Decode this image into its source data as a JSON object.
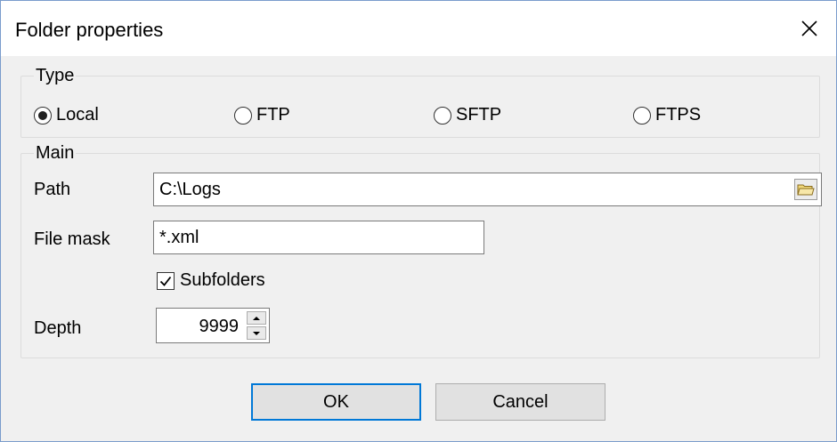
{
  "window": {
    "title": "Folder properties"
  },
  "type_group": {
    "legend": "Type",
    "options": [
      {
        "label": "Local",
        "checked": true
      },
      {
        "label": "FTP",
        "checked": false
      },
      {
        "label": "SFTP",
        "checked": false
      },
      {
        "label": "FTPS",
        "checked": false
      }
    ]
  },
  "main_group": {
    "legend": "Main",
    "path_label": "Path",
    "path_value": "C:\\Logs",
    "filemask_label": "File mask",
    "filemask_value": "*.xml",
    "subfolders_label": "Subfolders",
    "subfolders_checked": true,
    "depth_label": "Depth",
    "depth_value": "9999"
  },
  "buttons": {
    "ok": "OK",
    "cancel": "Cancel"
  },
  "icons": {
    "close": "close-icon",
    "browse": "folder-open-icon",
    "spin_up": "spin-up-icon",
    "spin_down": "spin-down-icon"
  },
  "colors": {
    "default_button_border": "#0078d7",
    "window_border": "#7a9ccc"
  }
}
